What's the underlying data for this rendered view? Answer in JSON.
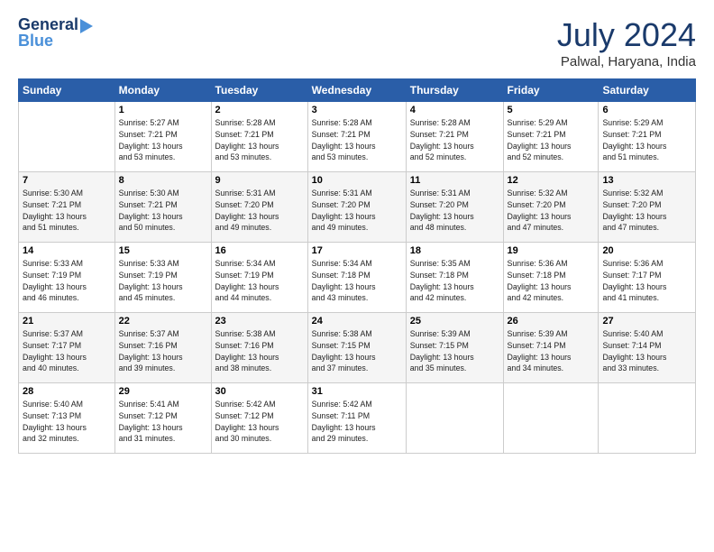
{
  "logo": {
    "line1": "General",
    "line2": "Blue"
  },
  "title": {
    "month_year": "July 2024",
    "location": "Palwal, Haryana, India"
  },
  "days_of_week": [
    "Sunday",
    "Monday",
    "Tuesday",
    "Wednesday",
    "Thursday",
    "Friday",
    "Saturday"
  ],
  "weeks": [
    [
      {
        "day": "",
        "info": ""
      },
      {
        "day": "1",
        "info": "Sunrise: 5:27 AM\nSunset: 7:21 PM\nDaylight: 13 hours\nand 53 minutes."
      },
      {
        "day": "2",
        "info": "Sunrise: 5:28 AM\nSunset: 7:21 PM\nDaylight: 13 hours\nand 53 minutes."
      },
      {
        "day": "3",
        "info": "Sunrise: 5:28 AM\nSunset: 7:21 PM\nDaylight: 13 hours\nand 53 minutes."
      },
      {
        "day": "4",
        "info": "Sunrise: 5:28 AM\nSunset: 7:21 PM\nDaylight: 13 hours\nand 52 minutes."
      },
      {
        "day": "5",
        "info": "Sunrise: 5:29 AM\nSunset: 7:21 PM\nDaylight: 13 hours\nand 52 minutes."
      },
      {
        "day": "6",
        "info": "Sunrise: 5:29 AM\nSunset: 7:21 PM\nDaylight: 13 hours\nand 51 minutes."
      }
    ],
    [
      {
        "day": "7",
        "info": "Sunrise: 5:30 AM\nSunset: 7:21 PM\nDaylight: 13 hours\nand 51 minutes."
      },
      {
        "day": "8",
        "info": "Sunrise: 5:30 AM\nSunset: 7:21 PM\nDaylight: 13 hours\nand 50 minutes."
      },
      {
        "day": "9",
        "info": "Sunrise: 5:31 AM\nSunset: 7:20 PM\nDaylight: 13 hours\nand 49 minutes."
      },
      {
        "day": "10",
        "info": "Sunrise: 5:31 AM\nSunset: 7:20 PM\nDaylight: 13 hours\nand 49 minutes."
      },
      {
        "day": "11",
        "info": "Sunrise: 5:31 AM\nSunset: 7:20 PM\nDaylight: 13 hours\nand 48 minutes."
      },
      {
        "day": "12",
        "info": "Sunrise: 5:32 AM\nSunset: 7:20 PM\nDaylight: 13 hours\nand 47 minutes."
      },
      {
        "day": "13",
        "info": "Sunrise: 5:32 AM\nSunset: 7:20 PM\nDaylight: 13 hours\nand 47 minutes."
      }
    ],
    [
      {
        "day": "14",
        "info": "Sunrise: 5:33 AM\nSunset: 7:19 PM\nDaylight: 13 hours\nand 46 minutes."
      },
      {
        "day": "15",
        "info": "Sunrise: 5:33 AM\nSunset: 7:19 PM\nDaylight: 13 hours\nand 45 minutes."
      },
      {
        "day": "16",
        "info": "Sunrise: 5:34 AM\nSunset: 7:19 PM\nDaylight: 13 hours\nand 44 minutes."
      },
      {
        "day": "17",
        "info": "Sunrise: 5:34 AM\nSunset: 7:18 PM\nDaylight: 13 hours\nand 43 minutes."
      },
      {
        "day": "18",
        "info": "Sunrise: 5:35 AM\nSunset: 7:18 PM\nDaylight: 13 hours\nand 42 minutes."
      },
      {
        "day": "19",
        "info": "Sunrise: 5:36 AM\nSunset: 7:18 PM\nDaylight: 13 hours\nand 42 minutes."
      },
      {
        "day": "20",
        "info": "Sunrise: 5:36 AM\nSunset: 7:17 PM\nDaylight: 13 hours\nand 41 minutes."
      }
    ],
    [
      {
        "day": "21",
        "info": "Sunrise: 5:37 AM\nSunset: 7:17 PM\nDaylight: 13 hours\nand 40 minutes."
      },
      {
        "day": "22",
        "info": "Sunrise: 5:37 AM\nSunset: 7:16 PM\nDaylight: 13 hours\nand 39 minutes."
      },
      {
        "day": "23",
        "info": "Sunrise: 5:38 AM\nSunset: 7:16 PM\nDaylight: 13 hours\nand 38 minutes."
      },
      {
        "day": "24",
        "info": "Sunrise: 5:38 AM\nSunset: 7:15 PM\nDaylight: 13 hours\nand 37 minutes."
      },
      {
        "day": "25",
        "info": "Sunrise: 5:39 AM\nSunset: 7:15 PM\nDaylight: 13 hours\nand 35 minutes."
      },
      {
        "day": "26",
        "info": "Sunrise: 5:39 AM\nSunset: 7:14 PM\nDaylight: 13 hours\nand 34 minutes."
      },
      {
        "day": "27",
        "info": "Sunrise: 5:40 AM\nSunset: 7:14 PM\nDaylight: 13 hours\nand 33 minutes."
      }
    ],
    [
      {
        "day": "28",
        "info": "Sunrise: 5:40 AM\nSunset: 7:13 PM\nDaylight: 13 hours\nand 32 minutes."
      },
      {
        "day": "29",
        "info": "Sunrise: 5:41 AM\nSunset: 7:12 PM\nDaylight: 13 hours\nand 31 minutes."
      },
      {
        "day": "30",
        "info": "Sunrise: 5:42 AM\nSunset: 7:12 PM\nDaylight: 13 hours\nand 30 minutes."
      },
      {
        "day": "31",
        "info": "Sunrise: 5:42 AM\nSunset: 7:11 PM\nDaylight: 13 hours\nand 29 minutes."
      },
      {
        "day": "",
        "info": ""
      },
      {
        "day": "",
        "info": ""
      },
      {
        "day": "",
        "info": ""
      }
    ]
  ]
}
